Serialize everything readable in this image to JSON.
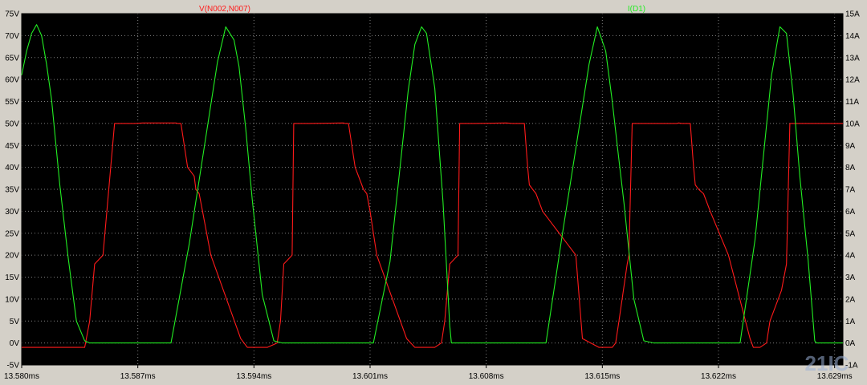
{
  "colors": {
    "background": "#d4d0c8",
    "plot_bg": "#000000",
    "grid": "#808080",
    "voltage": "#ff1a1a",
    "current": "#22ee22",
    "tick_text": "#000000",
    "watermark": "#9ab0d6"
  },
  "watermark_text": "21IC",
  "chart_data": {
    "type": "line",
    "title": "",
    "xlabel": "",
    "grid": true,
    "legend_placement": "top",
    "x_range": [
      13.58,
      13.6295
    ],
    "x_ticks": [
      13.58,
      13.587,
      13.594,
      13.601,
      13.608,
      13.615,
      13.622,
      13.629
    ],
    "x_tick_labels": [
      "13.580ms",
      "13.587ms",
      "13.594ms",
      "13.601ms",
      "13.608ms",
      "13.615ms",
      "13.622ms",
      "13.629ms"
    ],
    "left_axis": {
      "range": [
        -5,
        75
      ],
      "ticks": [
        -5,
        0,
        5,
        10,
        15,
        20,
        25,
        30,
        35,
        40,
        45,
        50,
        55,
        60,
        65,
        70,
        75
      ],
      "tick_labels": [
        "-5V",
        "0V",
        "5V",
        "10V",
        "15V",
        "20V",
        "25V",
        "30V",
        "35V",
        "40V",
        "45V",
        "50V",
        "55V",
        "60V",
        "65V",
        "70V",
        "75V"
      ]
    },
    "right_axis": {
      "range": [
        -1,
        15
      ],
      "ticks": [
        -1,
        0,
        1,
        2,
        3,
        4,
        5,
        6,
        7,
        8,
        9,
        10,
        11,
        12,
        13,
        14,
        15
      ],
      "tick_labels": [
        "-1A",
        "0A",
        "1A",
        "2A",
        "3A",
        "4A",
        "5A",
        "6A",
        "7A",
        "8A",
        "9A",
        "10A",
        "11A",
        "12A",
        "13A",
        "14A",
        "15A"
      ]
    },
    "series": [
      {
        "name": "V(N002,N007)",
        "axis": "left",
        "x": [
          13.58,
          13.5834,
          13.5838,
          13.5841,
          13.5844,
          13.5849,
          13.5856,
          13.5861,
          13.5862,
          13.5863,
          13.5864,
          13.5866,
          13.5868,
          13.5873,
          13.5893,
          13.5894,
          13.5896,
          13.59,
          13.5904,
          13.5905,
          13.5907,
          13.5909,
          13.5914,
          13.5932,
          13.5936,
          13.5946,
          13.5948,
          13.5954,
          13.5956,
          13.5958,
          13.5963,
          13.5964,
          13.5967,
          13.5969,
          13.5973,
          13.5994,
          13.5995,
          13.5997,
          13.6001,
          13.6005,
          13.6006,
          13.6008,
          13.601,
          13.6014,
          13.6032,
          13.6037,
          13.6047,
          13.6049,
          13.6053,
          13.6055,
          13.6058,
          13.6063,
          13.6064,
          13.6067,
          13.6069,
          13.6073,
          13.6092,
          13.6096,
          13.6103,
          13.6105,
          13.6106,
          13.6108,
          13.611,
          13.6114,
          13.6134,
          13.6138,
          13.6148,
          13.615,
          13.6156,
          13.6158,
          13.616,
          13.6165,
          13.6166,
          13.6168,
          13.6171,
          13.6175,
          13.6195,
          13.6196,
          13.6198,
          13.6203,
          13.6205,
          13.6206,
          13.6208,
          13.6211,
          13.6215,
          13.6226,
          13.6239,
          13.6241,
          13.6245,
          13.6249,
          13.6251,
          13.6258,
          13.6261,
          13.6263,
          13.6265,
          13.6267,
          13.6295
        ],
        "y": [
          -1,
          -1,
          -1,
          5,
          18,
          20,
          50,
          50,
          50,
          50,
          50,
          50,
          50,
          50.1,
          50.1,
          50,
          50,
          40,
          38,
          35,
          34,
          30,
          20,
          1,
          -1,
          -1,
          -1,
          0,
          5,
          18,
          20,
          50,
          50,
          50,
          50,
          50.1,
          50,
          50,
          40,
          36,
          35,
          34,
          30,
          20,
          1,
          -1,
          -1,
          -1,
          0,
          5,
          18,
          20,
          50,
          50,
          50,
          50,
          50.1,
          50,
          50,
          40,
          36,
          35,
          34,
          30,
          20,
          1,
          -1,
          -1,
          -1,
          0,
          5,
          18,
          20,
          50,
          50,
          50,
          50,
          50.1,
          50,
          50,
          40,
          36,
          35,
          34,
          30,
          20,
          1,
          -1,
          -1,
          0,
          5,
          12,
          18,
          50,
          50,
          50,
          50
        ]
      },
      {
        "name": "I(D1)",
        "axis": "right",
        "x": [
          13.58,
          13.5803,
          13.5806,
          13.5809,
          13.5812,
          13.5815,
          13.5818,
          13.5823,
          13.5828,
          13.5833,
          13.5838,
          13.5841,
          13.5842,
          13.589,
          13.5901,
          13.5918,
          13.5923,
          13.5928,
          13.5931,
          13.5935,
          13.5939,
          13.5945,
          13.5952,
          13.5957,
          13.5958,
          13.6012,
          13.6022,
          13.6033,
          13.6037,
          13.6041,
          13.6044,
          13.6049,
          13.6054,
          13.6058,
          13.6059,
          13.6116,
          13.6126,
          13.6142,
          13.6147,
          13.6152,
          13.6156,
          13.6159,
          13.6163,
          13.6169,
          13.6175,
          13.6181,
          13.6182,
          13.6233,
          13.6242,
          13.6252,
          13.6257,
          13.6261,
          13.6265,
          13.6269,
          13.6274,
          13.6278,
          13.6279,
          13.6295
        ],
        "y": [
          12.2,
          13.3,
          14.1,
          14.5,
          14.0,
          12.7,
          11.1,
          7.2,
          3.9,
          1.0,
          0.1,
          0.0,
          0.0,
          0.0,
          4.5,
          12.8,
          14.4,
          13.8,
          12.6,
          9.8,
          6.5,
          2.2,
          0.1,
          0.0,
          0.0,
          0.0,
          3.7,
          11.5,
          13.6,
          14.4,
          14.1,
          11.6,
          6.4,
          0.8,
          0.0,
          0.0,
          5.0,
          12.7,
          14.4,
          13.3,
          11.0,
          9.0,
          6.4,
          2.0,
          0.1,
          0.0,
          0.0,
          0.0,
          4.7,
          12.2,
          14.4,
          14.1,
          11.3,
          7.6,
          3.8,
          0.1,
          0.0,
          0.0
        ]
      }
    ]
  }
}
